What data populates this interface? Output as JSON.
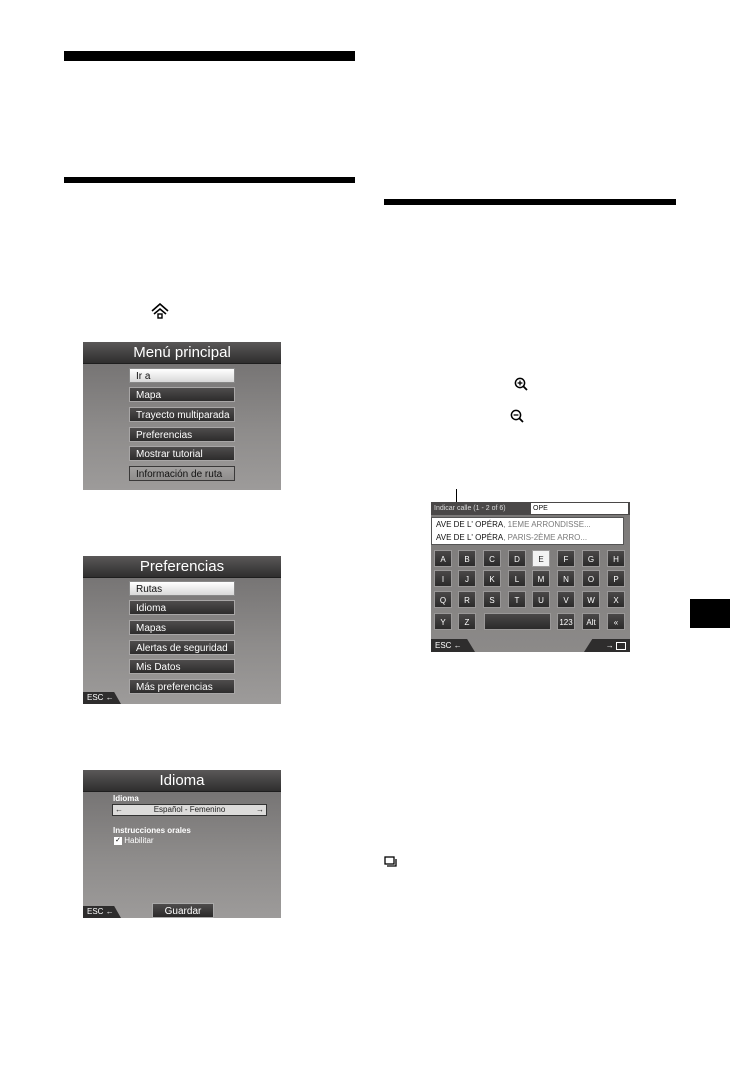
{
  "icons": {
    "home": "home-icon",
    "zoom_in": "zoom-in-icon",
    "zoom_out": "zoom-out-icon",
    "map_toggle": "map-view-icon"
  },
  "main_menu": {
    "title": "Menú principal",
    "items": [
      "Ir a",
      "Mapa",
      "Trayecto multiparada",
      "Preferencias",
      "Mostrar tutorial",
      "Información de ruta"
    ],
    "selected_index": 0
  },
  "preferences": {
    "title": "Preferencias",
    "items": [
      "Rutas",
      "Idioma",
      "Mapas",
      "Alertas de seguridad",
      "Mis Datos",
      "Más preferencias"
    ],
    "selected_index": 0,
    "esc_label": "ESC"
  },
  "language": {
    "title": "Idioma",
    "section_label": "Idioma",
    "current_value": "Español - Femenino",
    "voice_label": "Instrucciones orales",
    "enable_label": "Habilitar",
    "enable_checked": true,
    "esc_label": "ESC",
    "save_label": "Guardar"
  },
  "keyboard": {
    "header_label": "Indicar calle (1 - 2 of 6)",
    "query": "OPE",
    "results": [
      {
        "bold": "AVE DE L' OPÉRA",
        "rest": ", 1EME ARRONDISSE..."
      },
      {
        "bold": "AVE DE L' OPÉRA",
        "rest": ", PARIS-2ÈME ARRO..."
      }
    ],
    "rows": [
      [
        "A",
        "B",
        "C",
        "D",
        "E",
        "F",
        "G",
        "H"
      ],
      [
        "I",
        "J",
        "K",
        "L",
        "M",
        "N",
        "O",
        "P"
      ],
      [
        "Q",
        "R",
        "S",
        "T",
        "U",
        "V",
        "W",
        "X"
      ],
      [
        "Y",
        "Z"
      ]
    ],
    "selected_key": "E",
    "num_key": "123",
    "alt_key": "Alt",
    "back_key": "«",
    "esc_label": "ESC"
  }
}
